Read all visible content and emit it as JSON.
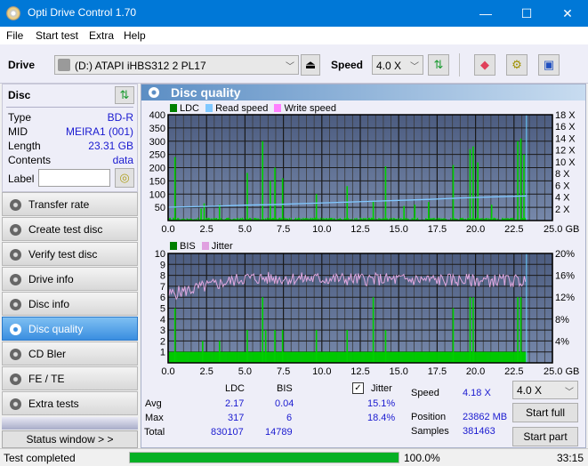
{
  "window": {
    "title": "Opti Drive Control 1.70",
    "minimize": "—",
    "maximize": "☐",
    "close": "✕"
  },
  "menu": [
    "File",
    "Start test",
    "Extra",
    "Help"
  ],
  "toolbar": {
    "drive_label": "Drive",
    "drive_value": "(D:)  ATAPI iHBS312  2 PL17",
    "speed_label": "Speed",
    "speed_value": "4.0 X"
  },
  "disc": {
    "header": "Disc",
    "rows": [
      {
        "k": "Type",
        "v": "BD-R"
      },
      {
        "k": "MID",
        "v": "MEIRA1 (001)"
      },
      {
        "k": "Length",
        "v": "23.31 GB"
      },
      {
        "k": "Contents",
        "v": "data"
      }
    ],
    "label_label": "Label",
    "label_value": ""
  },
  "nav": [
    {
      "label": "Transfer rate",
      "active": false
    },
    {
      "label": "Create test disc",
      "active": false
    },
    {
      "label": "Verify test disc",
      "active": false
    },
    {
      "label": "Drive info",
      "active": false
    },
    {
      "label": "Disc info",
      "active": false
    },
    {
      "label": "Disc quality",
      "active": true
    },
    {
      "label": "CD Bler",
      "active": false
    },
    {
      "label": "FE / TE",
      "active": false
    },
    {
      "label": "Extra tests",
      "active": false
    }
  ],
  "status_window_button": "Status window > >",
  "panel_title": "Disc quality",
  "chart_data": [
    {
      "type": "bar",
      "title": "LDC",
      "legend": [
        {
          "name": "LDC",
          "color": "#008000"
        },
        {
          "name": "Read speed",
          "color": "#80c8ff"
        },
        {
          "name": "Write speed",
          "color": "#ff80ff"
        }
      ],
      "xlabel": "GB",
      "x_ticks": [
        "0.0",
        "2.5",
        "5.0",
        "7.5",
        "10.0",
        "12.5",
        "15.0",
        "17.5",
        "20.0",
        "22.5",
        "25.0 GB"
      ],
      "xlim": [
        0,
        25
      ],
      "ylim": [
        0,
        400
      ],
      "y_ticks": [
        "400",
        "350",
        "300",
        "250",
        "200",
        "150",
        "100",
        "50"
      ],
      "y2_ticks": [
        "18 X",
        "16 X",
        "14 X",
        "12 X",
        "10 X",
        "8 X",
        "6 X",
        "4 X",
        "2 X"
      ],
      "y2lim": [
        0,
        18
      ],
      "ldc_spikes": [
        [
          0.4,
          240
        ],
        [
          2.1,
          45
        ],
        [
          2.3,
          65
        ],
        [
          3.3,
          60
        ],
        [
          5.1,
          180
        ],
        [
          6.1,
          300
        ],
        [
          6.6,
          150
        ],
        [
          6.9,
          200
        ],
        [
          7.4,
          160
        ],
        [
          9.6,
          100
        ],
        [
          11.6,
          130
        ],
        [
          13.3,
          75
        ],
        [
          14.1,
          205
        ],
        [
          15.3,
          55
        ],
        [
          16.0,
          60
        ],
        [
          16.9,
          70
        ],
        [
          18.5,
          210
        ],
        [
          19.6,
          270
        ],
        [
          19.8,
          280
        ],
        [
          20.1,
          220
        ],
        [
          21.0,
          60
        ],
        [
          22.7,
          300
        ],
        [
          22.9,
          310
        ],
        [
          23.1,
          250
        ]
      ],
      "read_speed": [
        [
          0,
          3.9
        ],
        [
          1,
          4.0
        ],
        [
          3,
          4.2
        ],
        [
          5,
          4.5
        ],
        [
          7,
          4.7
        ],
        [
          9,
          5.0
        ],
        [
          11,
          5.3
        ],
        [
          13,
          5.6
        ],
        [
          15,
          5.9
        ],
        [
          17,
          6.2
        ],
        [
          19,
          6.6
        ],
        [
          21,
          6.9
        ],
        [
          23.3,
          7.2
        ]
      ],
      "end_marker_gb": 23.31
    },
    {
      "type": "bar",
      "title": "BIS / Jitter",
      "legend": [
        {
          "name": "BIS",
          "color": "#008000"
        },
        {
          "name": "Jitter",
          "color": "#e0a0e0"
        }
      ],
      "xlabel": "GB",
      "x_ticks": [
        "0.0",
        "2.5",
        "5.0",
        "7.5",
        "10.0",
        "12.5",
        "15.0",
        "17.5",
        "20.0",
        "22.5",
        "25.0 GB"
      ],
      "xlim": [
        0,
        25
      ],
      "ylim": [
        0,
        10
      ],
      "y_ticks": [
        "10",
        "9",
        "8",
        "7",
        "6",
        "5",
        "4",
        "3",
        "2",
        "1"
      ],
      "y2_ticks": [
        "20%",
        "16%",
        "12%",
        "8%",
        "4%"
      ],
      "y2lim": [
        0,
        20
      ],
      "bis_spikes": [
        [
          0.4,
          5
        ],
        [
          2.2,
          2
        ],
        [
          3.3,
          2
        ],
        [
          5.1,
          3
        ],
        [
          6.1,
          6
        ],
        [
          6.3,
          3
        ],
        [
          6.9,
          3
        ],
        [
          7.4,
          3
        ],
        [
          9.6,
          3
        ],
        [
          11.6,
          3
        ],
        [
          13.3,
          6
        ],
        [
          14.1,
          3
        ],
        [
          18.5,
          5
        ],
        [
          19.6,
          6
        ],
        [
          19.8,
          6
        ],
        [
          22.7,
          6
        ],
        [
          22.9,
          6
        ]
      ],
      "jitter_start_pct": 12.5,
      "jitter_mid_pct": 15.5,
      "jitter_end_pct": 15.0,
      "end_marker_gb": 23.31
    }
  ],
  "stats": {
    "col_ldc": "LDC",
    "col_bis": "BIS",
    "rows": [
      {
        "k": "Avg",
        "ldc": "2.17",
        "bis": "0.04",
        "jitter": "15.1%"
      },
      {
        "k": "Max",
        "ldc": "317",
        "bis": "6",
        "jitter": "18.4%"
      },
      {
        "k": "Total",
        "ldc": "830107",
        "bis": "14789",
        "jitter": ""
      }
    ],
    "jitter_label": "Jitter",
    "jitter_checked": true,
    "speed_label": "Speed",
    "speed_value": "4.18 X",
    "position_label": "Position",
    "position_value": "23862 MB",
    "samples_label": "Samples",
    "samples_value": "381463",
    "speed_select": "4.0 X",
    "start_full": "Start full",
    "start_part": "Start part"
  },
  "statusbar": {
    "text": "Test completed",
    "progress_pct": 100,
    "progress_label": "100.0%",
    "time": "33:15"
  }
}
